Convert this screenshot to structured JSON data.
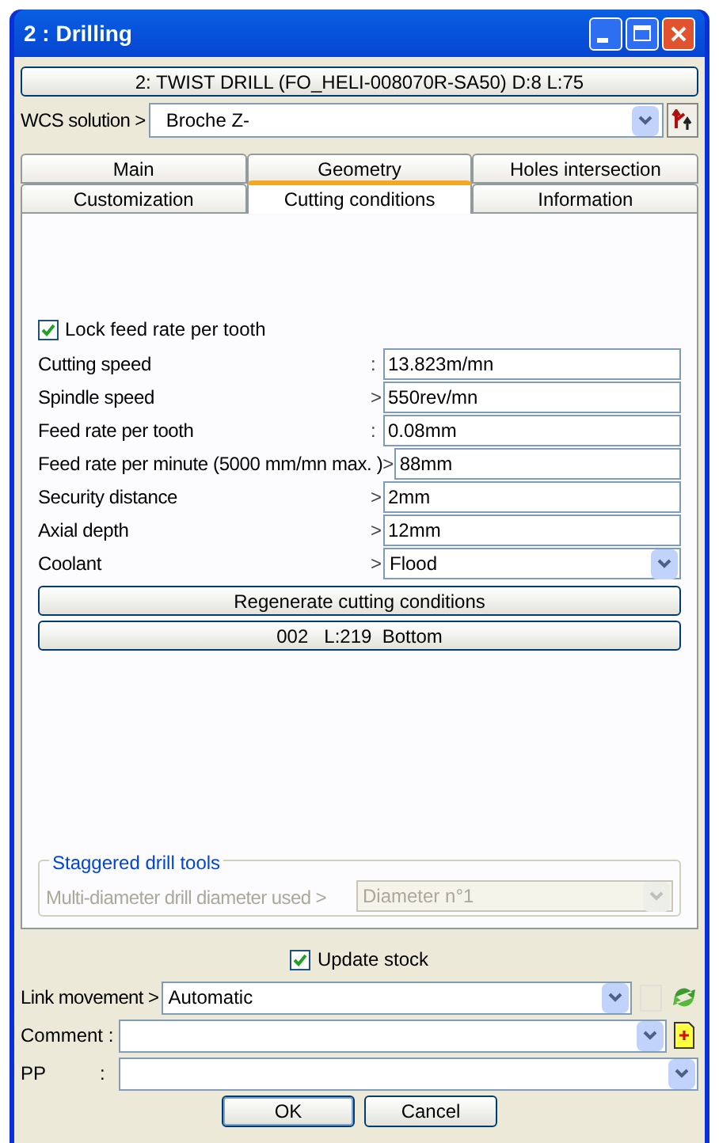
{
  "window": {
    "title": "2 : Drilling"
  },
  "tool_button": "2: TWIST DRILL (FO_HELI-008070R-SA50)  D:8  L:75",
  "wcs": {
    "label": "WCS solution >",
    "value": "Broche  Z-"
  },
  "tab_rows": [
    [
      {
        "label": "Main",
        "selected": false
      },
      {
        "label": "Geometry",
        "selected": false
      },
      {
        "label": "Holes intersection",
        "selected": false
      }
    ],
    [
      {
        "label": "Customization",
        "selected": false
      },
      {
        "label": "Cutting conditions",
        "selected": true
      },
      {
        "label": "Information",
        "selected": false
      }
    ]
  ],
  "lock_feed": {
    "label": "Lock feed rate per tooth",
    "checked": true
  },
  "fields": [
    {
      "label": "Cutting speed",
      "separator": ":",
      "value": "13.823m/mn",
      "kind": "text"
    },
    {
      "label": "Spindle speed",
      "separator": ">",
      "value": "550rev/mn",
      "kind": "text"
    },
    {
      "label": "Feed rate per tooth",
      "separator": ":",
      "value": "0.08mm",
      "kind": "text"
    },
    {
      "label": "Feed rate per minute (5000 mm/mn max. )",
      "separator": ">",
      "value": "88mm",
      "kind": "text"
    },
    {
      "label": "Security distance",
      "separator": ">",
      "value": "2mm",
      "kind": "text"
    },
    {
      "label": "Axial depth",
      "separator": ">",
      "value": "12mm",
      "kind": "text"
    },
    {
      "label": "Coolant",
      "separator": ">",
      "value": "Flood",
      "kind": "dropdown"
    }
  ],
  "panel_buttons": [
    "Regenerate cutting conditions",
    "002   L:219  Bottom"
  ],
  "staggered": {
    "title": "Staggered drill tools",
    "label": "Multi-diameter drill diameter used >",
    "value": "Diameter n°1",
    "disabled": true
  },
  "update_stock": {
    "label": "Update stock",
    "checked": true
  },
  "link_movement": {
    "label": "Link movement >",
    "value": "Automatic"
  },
  "comment": {
    "label": "Comment :"
  },
  "pp": {
    "label": "PP",
    "separator": ":"
  },
  "footer_buttons": [
    "OK",
    "Cancel"
  ]
}
